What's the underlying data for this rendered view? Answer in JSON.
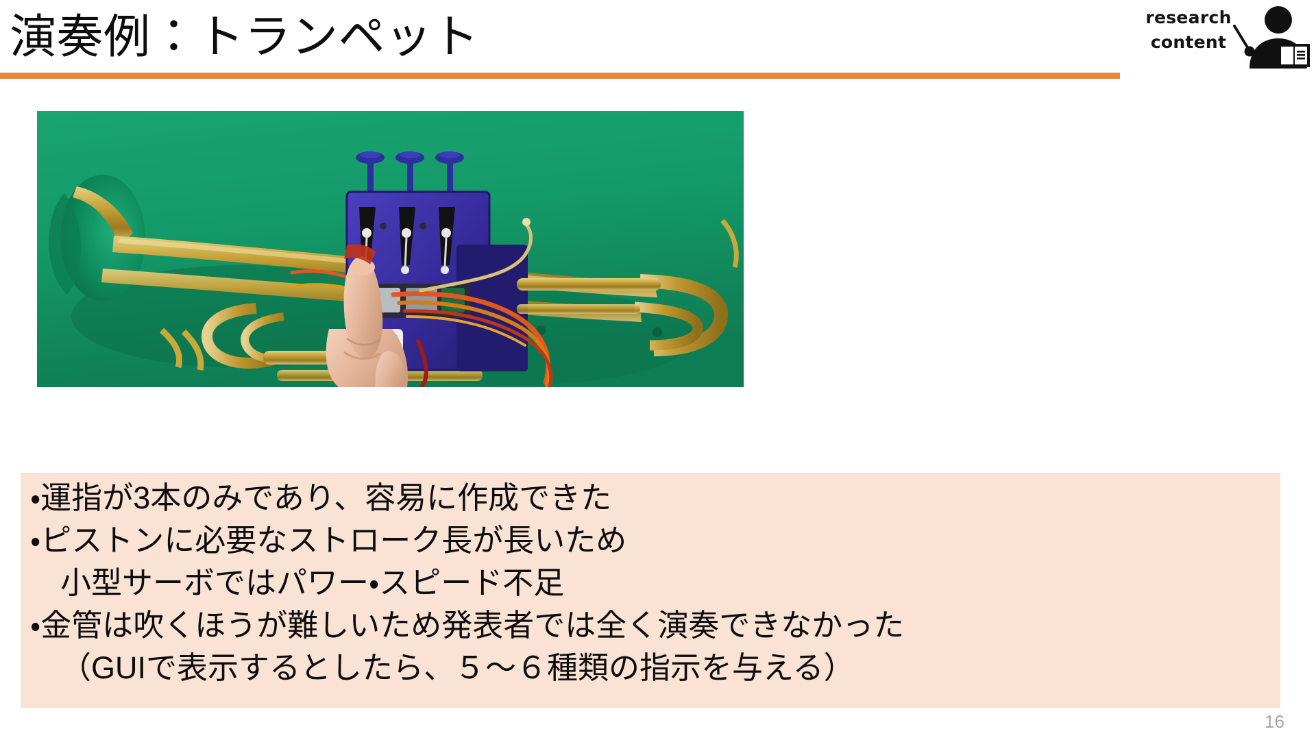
{
  "slide": {
    "title": "演奏例：トランペット",
    "page_number": "16",
    "accent_color": "#e8863c",
    "panel_color": "#fae3d5",
    "text_color": "#0d0d0d",
    "page_number_color": "#a6a6a6"
  },
  "logo": {
    "line1": "research",
    "line2": "content",
    "icon": "presenter-with-book-icon",
    "color": "#141414"
  },
  "photo": {
    "caption_alt": "緑背景のトランペットに青い3Dプリント製サーボマウントを取り付け手で保持している写真",
    "background_color": "#17996b",
    "brass_color": "#c9a227",
    "mount_color": "#3b2f9e",
    "wire_colors": [
      "#e2571e",
      "#d4a017",
      "#b01c1c"
    ]
  },
  "body": {
    "lines": [
      {
        "text": "・運指が3本のみであり、容易に作成できた",
        "indent": false
      },
      {
        "text": "・ピストンに必要なストローク長が長いため",
        "indent": false
      },
      {
        "text": "小型サーボではパワー・スピード不足",
        "indent": true
      },
      {
        "text": "・金管は吹くほうが難しいため発表者では全く演奏できなかった",
        "indent": false
      },
      {
        "text": "（GUIで表示するとしたら、５～６種類の指示を与える）",
        "indent": true
      }
    ]
  }
}
